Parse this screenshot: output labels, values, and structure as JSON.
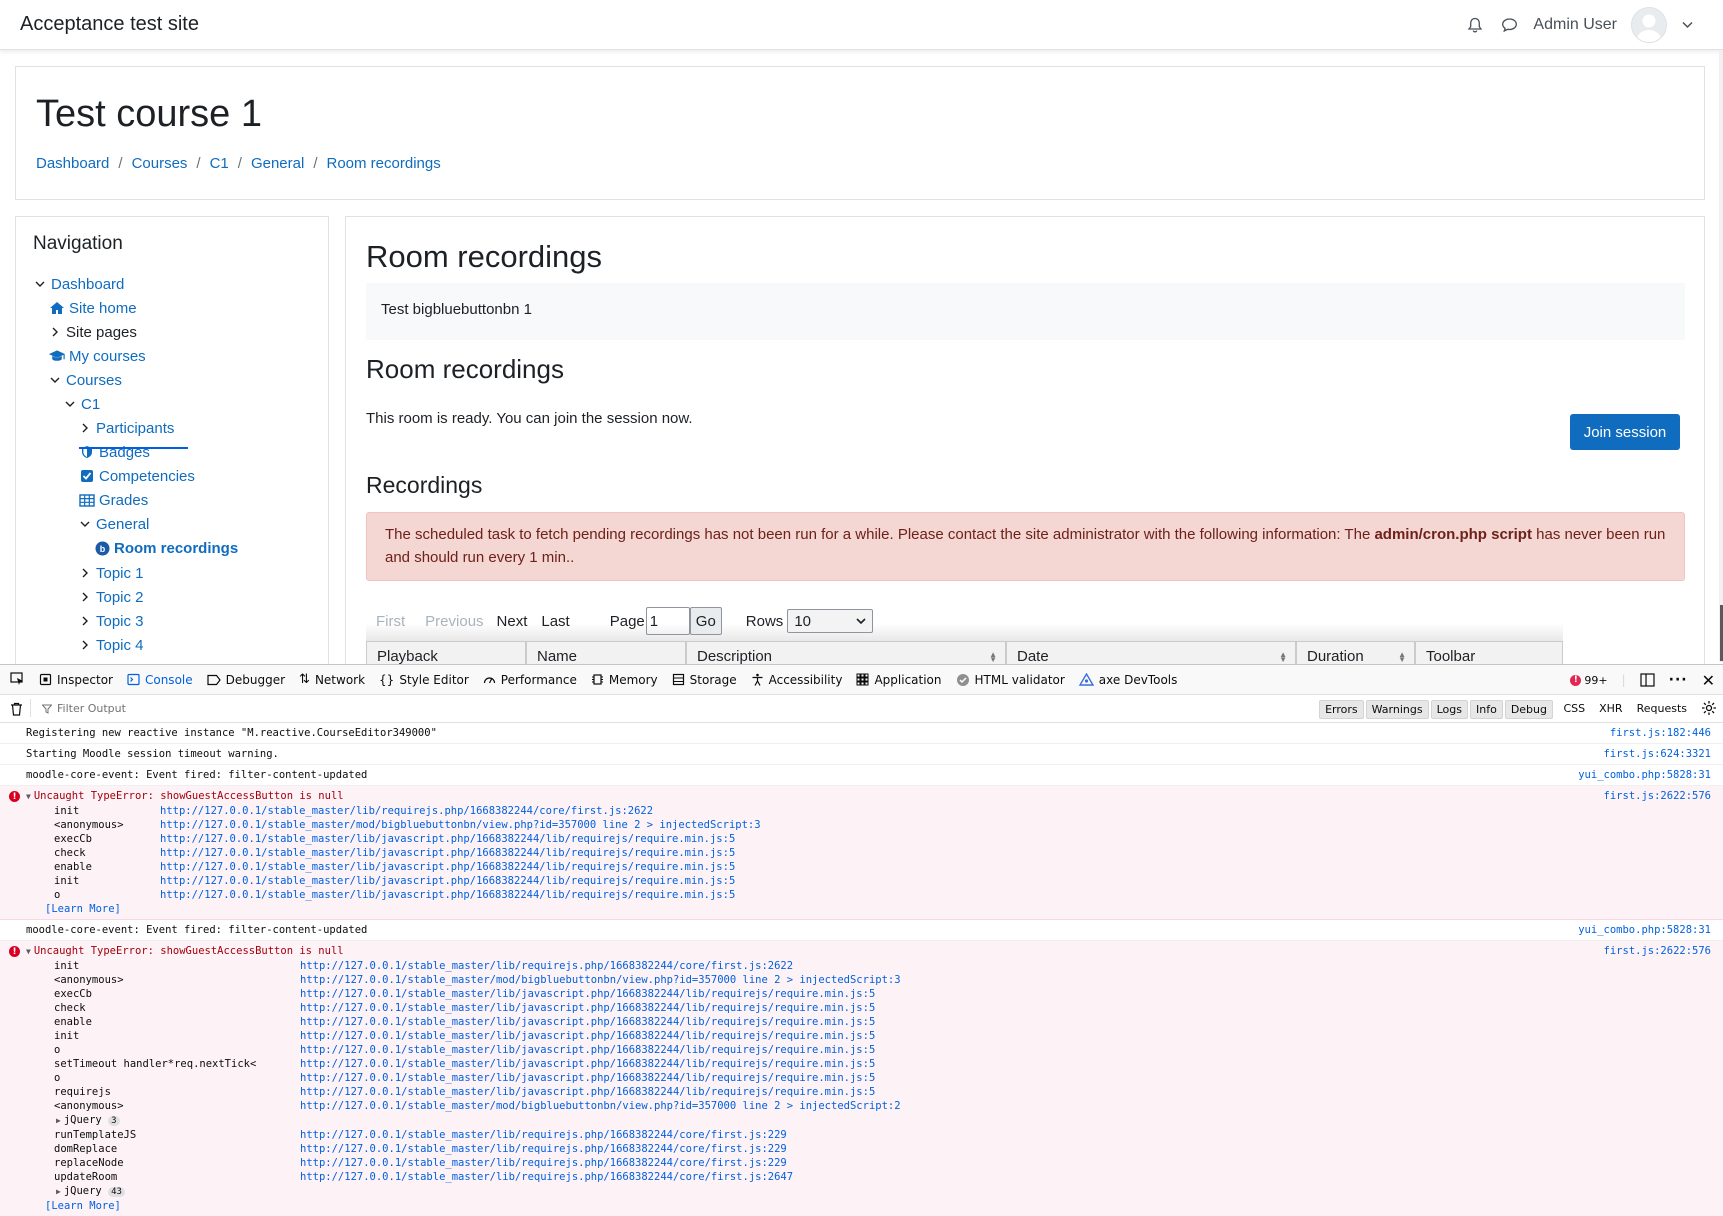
{
  "site": {
    "name": "Acceptance test site",
    "user": "Admin User"
  },
  "header": {
    "course_title": "Test course 1",
    "breadcrumb": [
      "Dashboard",
      "Courses",
      "C1",
      "General",
      "Room recordings"
    ]
  },
  "navigation": {
    "title": "Navigation",
    "items": [
      {
        "label": "Dashboard",
        "chevron": "down",
        "icon": null,
        "link": true
      },
      {
        "label": "Site home",
        "chevron": null,
        "icon": "home-icon",
        "link": true
      },
      {
        "label": "Site pages",
        "chevron": "right",
        "icon": null,
        "link": false
      },
      {
        "label": "My courses",
        "chevron": null,
        "icon": "graduation-cap-icon",
        "link": true
      },
      {
        "label": "Courses",
        "chevron": "down",
        "icon": null,
        "link": true
      },
      {
        "label": "C1",
        "chevron": "down",
        "icon": null,
        "link": true
      },
      {
        "label": "Participants",
        "chevron": "right",
        "icon": null,
        "link": true
      },
      {
        "label": "Badges",
        "chevron": null,
        "icon": "shield-icon",
        "link": true
      },
      {
        "label": "Competencies",
        "chevron": null,
        "icon": "checkbox-icon",
        "link": true
      },
      {
        "label": "Grades",
        "chevron": null,
        "icon": "table-icon",
        "link": true
      },
      {
        "label": "General",
        "chevron": "down",
        "icon": null,
        "link": true
      },
      {
        "label": "Room recordings",
        "chevron": null,
        "icon": "bigbluebutton-icon",
        "link": true,
        "active": true
      },
      {
        "label": "Topic 1",
        "chevron": "right",
        "icon": null,
        "link": true
      },
      {
        "label": "Topic 2",
        "chevron": "right",
        "icon": null,
        "link": true
      },
      {
        "label": "Topic 3",
        "chevron": "right",
        "icon": null,
        "link": true
      },
      {
        "label": "Topic 4",
        "chevron": "right",
        "icon": null,
        "link": true
      }
    ]
  },
  "main": {
    "heading": "Room recordings",
    "intro": "Test bigbluebuttonbn 1",
    "room_heading": "Room recordings",
    "ready_text": "This room is ready. You can join the session now.",
    "join_button": "Join session",
    "recordings_heading": "Recordings",
    "alert_pre": "The scheduled task to fetch pending recordings has not been run for a while. Please contact the site administrator with the following information: The ",
    "alert_bold": "admin/cron.php script",
    "alert_post": " has never been run and should run every 1 min..",
    "pager": {
      "first": "First",
      "previous": "Previous",
      "next": "Next",
      "last": "Last",
      "page_label": "Page",
      "page_value": "1",
      "go": "Go",
      "rows_label": "Rows",
      "rows_value": "10"
    },
    "columns": [
      "Playback",
      "Name",
      "Description",
      "Date",
      "Duration",
      "Toolbar"
    ]
  },
  "devtools": {
    "tabs": [
      "Inspector",
      "Console",
      "Debugger",
      "Network",
      "Style Editor",
      "Performance",
      "Memory",
      "Storage",
      "Accessibility",
      "Application",
      "HTML validator",
      "axe DevTools"
    ],
    "selected_tab": "Console",
    "error_count": "99+",
    "filter_placeholder": "Filter Output",
    "levels": [
      "Errors",
      "Warnings",
      "Logs",
      "Info",
      "Debug"
    ],
    "extra": [
      "CSS",
      "XHR",
      "Requests"
    ],
    "messages": [
      {
        "type": "log",
        "text": "Registering new reactive instance \"M.reactive.CourseEditor349000\"",
        "loc": "first.js:182:446"
      },
      {
        "type": "log",
        "text": "Starting Moodle session timeout warning.",
        "loc": "first.js:624:3321"
      },
      {
        "type": "log",
        "text": "moodle-core-event: Event fired: filter-content-updated",
        "loc": "yui_combo.php:5828:31"
      }
    ],
    "error1": {
      "text": "Uncaught TypeError: showGuestAccessButton is null",
      "loc": "first.js:2622:576",
      "frames": [
        {
          "fn": "init",
          "url": "http://127.0.0.1/stable_master/lib/requirejs.php/1668382244/core/first.js:2622"
        },
        {
          "fn": "<anonymous>",
          "url": "http://127.0.0.1/stable_master/mod/bigbluebuttonbn/view.php?id=357000 line 2 > injectedScript:3"
        },
        {
          "fn": "execCb",
          "url": "http://127.0.0.1/stable_master/lib/javascript.php/1668382244/lib/requirejs/require.min.js:5"
        },
        {
          "fn": "check",
          "url": "http://127.0.0.1/stable_master/lib/javascript.php/1668382244/lib/requirejs/require.min.js:5"
        },
        {
          "fn": "enable",
          "url": "http://127.0.0.1/stable_master/lib/javascript.php/1668382244/lib/requirejs/require.min.js:5"
        },
        {
          "fn": "init",
          "url": "http://127.0.0.1/stable_master/lib/javascript.php/1668382244/lib/requirejs/require.min.js:5"
        },
        {
          "fn": "o",
          "url": "http://127.0.0.1/stable_master/lib/javascript.php/1668382244/lib/requirejs/require.min.js:5"
        }
      ],
      "learn_more": "[Learn More]"
    },
    "log4": {
      "text": "moodle-core-event: Event fired: filter-content-updated",
      "loc": "yui_combo.php:5828:31"
    },
    "error2": {
      "text": "Uncaught TypeError: showGuestAccessButton is null",
      "loc": "first.js:2622:576",
      "frames_a": [
        {
          "fn": "init",
          "url": "http://127.0.0.1/stable_master/lib/requirejs.php/1668382244/core/first.js:2622"
        },
        {
          "fn": "<anonymous>",
          "url": "http://127.0.0.1/stable_master/mod/bigbluebuttonbn/view.php?id=357000 line 2 > injectedScript:3"
        },
        {
          "fn": "execCb",
          "url": "http://127.0.0.1/stable_master/lib/javascript.php/1668382244/lib/requirejs/require.min.js:5"
        },
        {
          "fn": "check",
          "url": "http://127.0.0.1/stable_master/lib/javascript.php/1668382244/lib/requirejs/require.min.js:5"
        },
        {
          "fn": "enable",
          "url": "http://127.0.0.1/stable_master/lib/javascript.php/1668382244/lib/requirejs/require.min.js:5"
        },
        {
          "fn": "init",
          "url": "http://127.0.0.1/stable_master/lib/javascript.php/1668382244/lib/requirejs/require.min.js:5"
        },
        {
          "fn": "o",
          "url": "http://127.0.0.1/stable_master/lib/javascript.php/1668382244/lib/requirejs/require.min.js:5"
        },
        {
          "fn": "setTimeout handler*req.nextTick<",
          "url": "http://127.0.0.1/stable_master/lib/javascript.php/1668382244/lib/requirejs/require.min.js:5"
        },
        {
          "fn": "o",
          "url": "http://127.0.0.1/stable_master/lib/javascript.php/1668382244/lib/requirejs/require.min.js:5"
        },
        {
          "fn": "requirejs",
          "url": "http://127.0.0.1/stable_master/lib/javascript.php/1668382244/lib/requirejs/require.min.js:5"
        },
        {
          "fn": "<anonymous>",
          "url": "http://127.0.0.1/stable_master/mod/bigbluebuttonbn/view.php?id=357000 line 2 > injectedScript:2"
        }
      ],
      "group1": {
        "label": "jQuery",
        "count": "3"
      },
      "frames_b": [
        {
          "fn": "runTemplateJS",
          "url": "http://127.0.0.1/stable_master/lib/requirejs.php/1668382244/core/first.js:229"
        },
        {
          "fn": "domReplace",
          "url": "http://127.0.0.1/stable_master/lib/requirejs.php/1668382244/core/first.js:229"
        },
        {
          "fn": "replaceNode",
          "url": "http://127.0.0.1/stable_master/lib/requirejs.php/1668382244/core/first.js:229"
        },
        {
          "fn": "updateRoom",
          "url": "http://127.0.0.1/stable_master/lib/requirejs.php/1668382244/core/first.js:2647"
        }
      ],
      "group2": {
        "label": "jQuery",
        "count": "43"
      },
      "learn_more": "[Learn More]"
    }
  }
}
